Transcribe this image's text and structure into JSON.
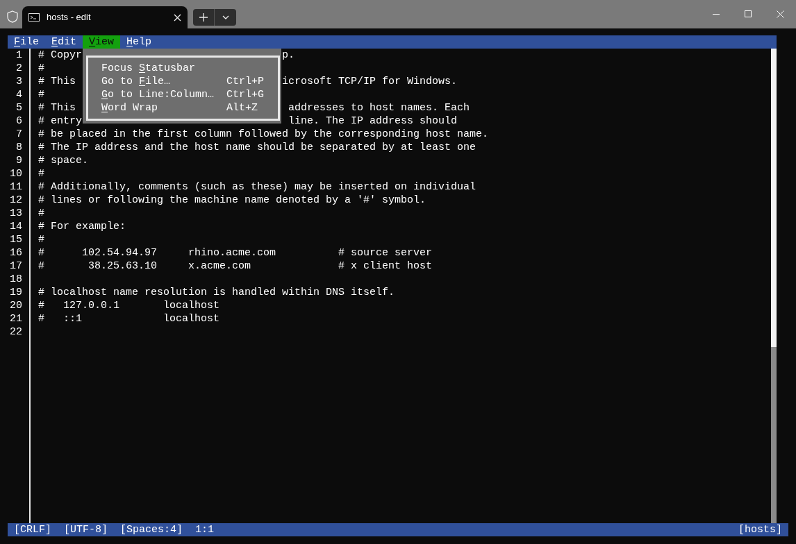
{
  "window": {
    "tab_title": "hosts - edit"
  },
  "menubar": [
    {
      "mnemonic": "F",
      "rest": "ile",
      "selected": false
    },
    {
      "mnemonic": "E",
      "rest": "dit",
      "selected": false
    },
    {
      "mnemonic": "V",
      "rest": "iew",
      "selected": true
    },
    {
      "mnemonic": "H",
      "rest": "elp",
      "selected": false
    }
  ],
  "open_menu": {
    "items": [
      {
        "before": "Focus ",
        "mnemonic": "S",
        "after": "tatusbar"
      },
      {
        "before": "Go to ",
        "mnemonic": "F",
        "after": "ile…",
        "shortcut": "Ctrl+P"
      },
      {
        "mnemonic": "G",
        "after": "o to Line:Column…",
        "shortcut": "Ctrl+G"
      },
      {
        "mnemonic": "W",
        "after": "ord Wrap",
        "shortcut": "Alt+Z"
      }
    ]
  },
  "editor": {
    "lines": [
      {
        "number": "1",
        "text": "# Copyr",
        "text_after": "p."
      },
      {
        "number": "2",
        "text": "#"
      },
      {
        "number": "3",
        "text": "# This",
        "text_after": "icrosoft TCP/IP for Windows."
      },
      {
        "number": "4",
        "text": "#"
      },
      {
        "number": "5",
        "text": "# This",
        "text_after": " addresses to host names. Each"
      },
      {
        "number": "6",
        "text": "# entry",
        "text_after": " line. The IP address should"
      },
      {
        "number": "7",
        "text": "# be placed in the first column followed by the corresponding host name."
      },
      {
        "number": "8",
        "text": "# The IP address and the host name should be separated by at least one"
      },
      {
        "number": "9",
        "text": "# space."
      },
      {
        "number": "10",
        "text": "#"
      },
      {
        "number": "11",
        "text": "# Additionally, comments (such as these) may be inserted on individual"
      },
      {
        "number": "12",
        "text": "# lines or following the machine name denoted by a '#' symbol."
      },
      {
        "number": "13",
        "text": "#"
      },
      {
        "number": "14",
        "text": "# For example:"
      },
      {
        "number": "15",
        "text": "#"
      },
      {
        "number": "16",
        "text": "#      102.54.94.97     rhino.acme.com          # source server"
      },
      {
        "number": "17",
        "text": "#       38.25.63.10     x.acme.com              # x client host"
      },
      {
        "number": "18"
      },
      {
        "number": "19",
        "text": "# localhost name resolution is handled within DNS itself."
      },
      {
        "number": "20",
        "text": "#   127.0.0.1       localhost"
      },
      {
        "number": "21",
        "text": "#   ::1             localhost"
      },
      {
        "number": "22"
      }
    ]
  },
  "status_bar": {
    "items": [
      "[CRLF]",
      "[UTF-8]",
      "[Spaces:4]",
      "1:1"
    ],
    "file": "[hosts]"
  }
}
